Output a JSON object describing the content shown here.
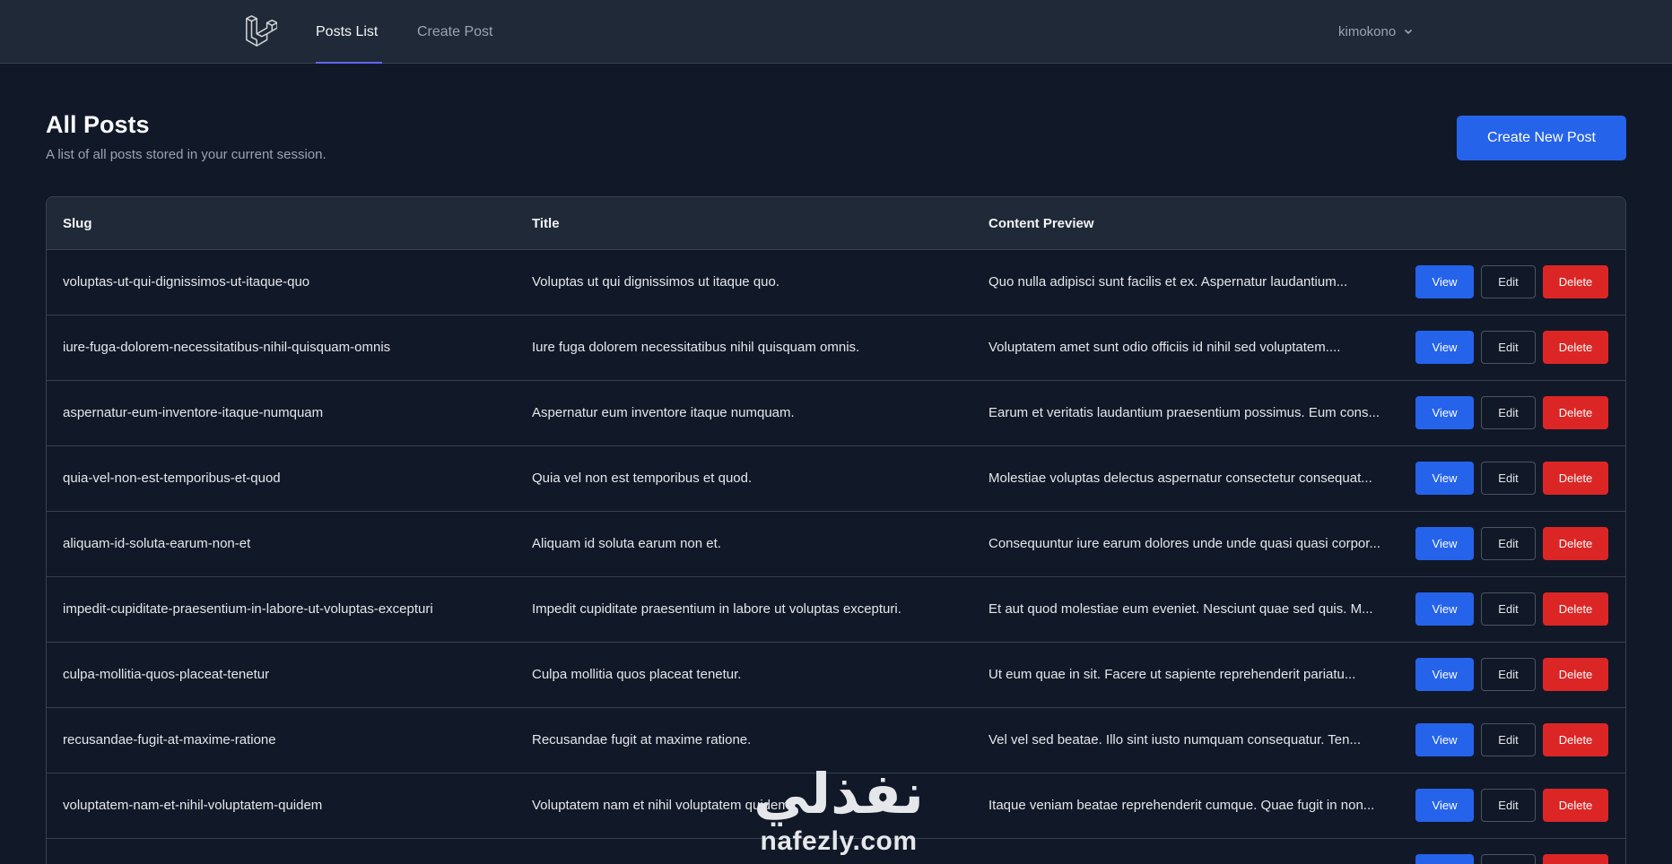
{
  "nav": {
    "links": [
      {
        "label": "Posts List",
        "active": true
      },
      {
        "label": "Create Post",
        "active": false
      }
    ],
    "user": "kimokono"
  },
  "header": {
    "title": "All Posts",
    "subtitle": "A list of all posts stored in your current session.",
    "create_button": "Create New Post"
  },
  "table": {
    "columns": [
      "Slug",
      "Title",
      "Content Preview"
    ],
    "actions": {
      "view": "View",
      "edit": "Edit",
      "delete": "Delete"
    },
    "rows": [
      {
        "slug": "voluptas-ut-qui-dignissimos-ut-itaque-quo",
        "title": "Voluptas ut qui dignissimos ut itaque quo.",
        "preview": "Quo nulla adipisci sunt facilis et ex. Aspernatur laudantium..."
      },
      {
        "slug": "iure-fuga-dolorem-necessitatibus-nihil-quisquam-omnis",
        "title": "Iure fuga dolorem necessitatibus nihil quisquam omnis.",
        "preview": "Voluptatem amet sunt odio officiis id nihil sed voluptatem...."
      },
      {
        "slug": "aspernatur-eum-inventore-itaque-numquam",
        "title": "Aspernatur eum inventore itaque numquam.",
        "preview": "Earum et veritatis laudantium praesentium possimus. Eum cons..."
      },
      {
        "slug": "quia-vel-non-est-temporibus-et-quod",
        "title": "Quia vel non est temporibus et quod.",
        "preview": "Molestiae voluptas delectus aspernatur consectetur consequat..."
      },
      {
        "slug": "aliquam-id-soluta-earum-non-et",
        "title": "Aliquam id soluta earum non et.",
        "preview": "Consequuntur iure earum dolores unde unde quasi quasi corpor..."
      },
      {
        "slug": "impedit-cupiditate-praesentium-in-labore-ut-voluptas-excepturi",
        "title": "Impedit cupiditate praesentium in labore ut voluptas excepturi.",
        "preview": "Et aut quod molestiae eum eveniet. Nesciunt quae sed quis. M..."
      },
      {
        "slug": "culpa-mollitia-quos-placeat-tenetur",
        "title": "Culpa mollitia quos placeat tenetur.",
        "preview": "Ut eum quae in sit. Facere ut sapiente reprehenderit pariatu..."
      },
      {
        "slug": "recusandae-fugit-at-maxime-ratione",
        "title": "Recusandae fugit at maxime ratione.",
        "preview": "Vel vel sed beatae. Illo sint iusto numquam consequatur. Ten..."
      },
      {
        "slug": "voluptatem-nam-et-nihil-voluptatem-quidem",
        "title": "Voluptatem nam et nihil voluptatem quidem.",
        "preview": "Itaque veniam beatae reprehenderit cumque. Quae fugit in non..."
      },
      {
        "slug": "",
        "title": "",
        "preview": ""
      }
    ]
  },
  "watermark": {
    "arabic": "نفذلي",
    "latin": "nafezly.com"
  },
  "colors": {
    "background": "#111827",
    "surface": "#1f2937",
    "primary": "#2563eb",
    "danger": "#dc2626",
    "accent": "#6366f1"
  },
  "icons": [
    "laravel-logo-icon",
    "chevron-down-icon"
  ]
}
